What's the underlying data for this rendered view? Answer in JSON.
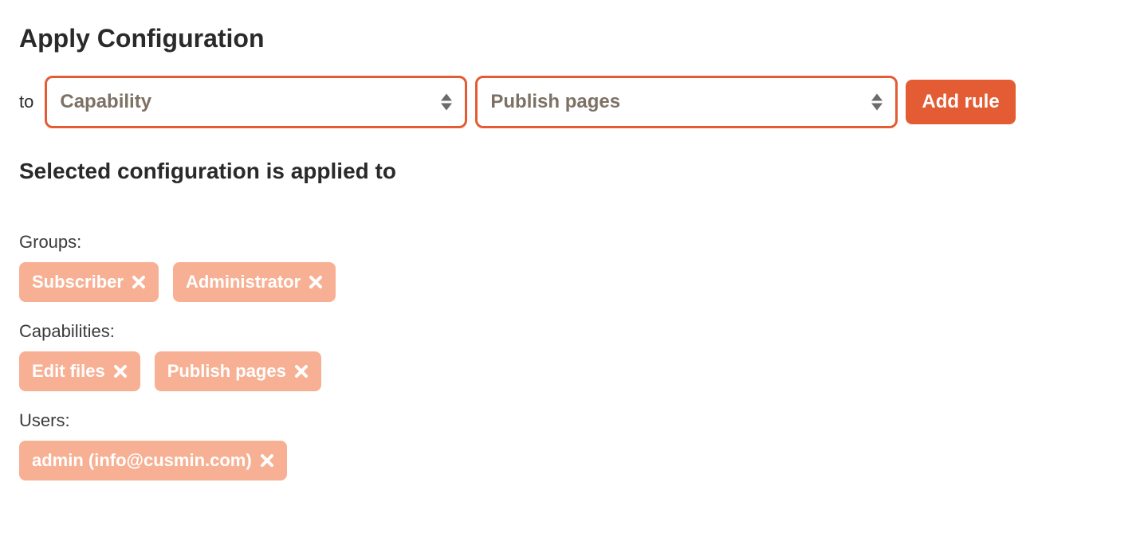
{
  "header": {
    "title": "Apply Configuration"
  },
  "ruleForm": {
    "toLabel": "to",
    "typeSelect": "Capability",
    "valueSelect": "Publish pages",
    "addButton": "Add rule"
  },
  "appliedHeading": "Selected configuration is applied to",
  "sections": {
    "groups": {
      "label": "Groups:",
      "items": [
        "Subscriber",
        "Administrator"
      ]
    },
    "capabilities": {
      "label": "Capabilities:",
      "items": [
        "Edit files",
        "Publish pages"
      ]
    },
    "users": {
      "label": "Users:",
      "items": [
        "admin (info@cusmin.com)"
      ]
    }
  }
}
